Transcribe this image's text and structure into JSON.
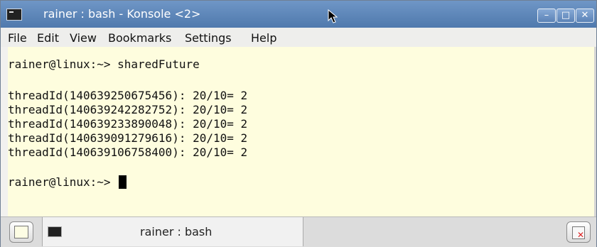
{
  "window": {
    "title": "rainer : bash - Konsole <2>",
    "controls": {
      "minimize": "–",
      "maximize": "□",
      "close": "✕"
    }
  },
  "menu": [
    "File",
    "Edit",
    "View",
    "Bookmarks",
    "Settings",
    "Help"
  ],
  "terminal": {
    "lines": [
      "rainer@linux:~> sharedFuture",
      "",
      "threadId(140639250675456): 20/10= 2",
      "threadId(140639242282752): 20/10= 2",
      "threadId(140639233890048): 20/10= 2",
      "threadId(140639091279616): 20/10= 2",
      "threadId(140639106758400): 20/10= 2",
      "",
      "rainer@linux:~> "
    ]
  },
  "tabs": [
    {
      "label": "rainer : bash",
      "icon": "terminal-icon"
    }
  ],
  "colors": {
    "titlebar": "#5f88bc",
    "terminal_bg": "#fefdde",
    "text": "#111111"
  }
}
